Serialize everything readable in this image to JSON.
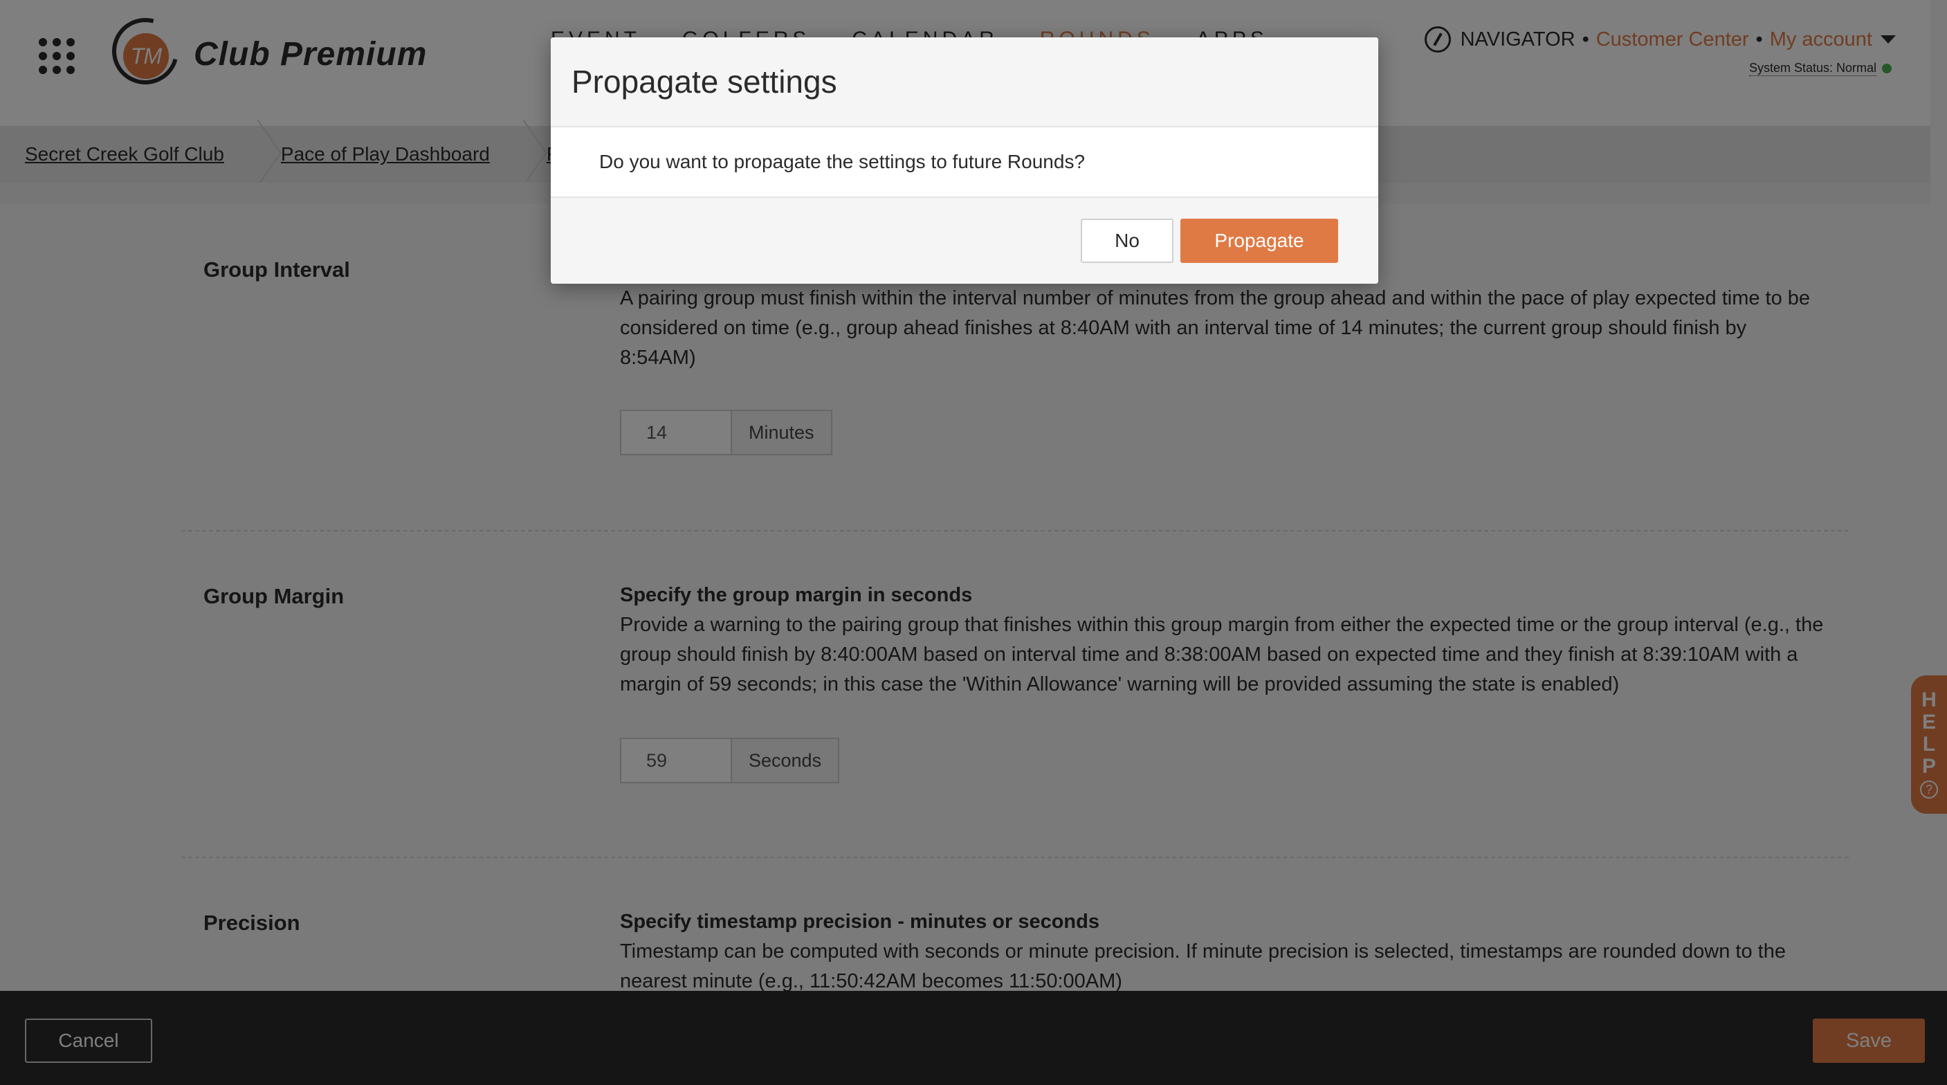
{
  "header": {
    "brand": "Club Premium",
    "logo_monogram": "TM",
    "nav": [
      "EVENT",
      "GOLFERS",
      "CALENDAR",
      "ROUNDS",
      "APPS"
    ],
    "navigator_label": "NAVIGATOR",
    "separator": "•",
    "customer_center": "Customer Center",
    "my_account": "My account",
    "system_status": "System Status: Normal",
    "accent_color": "#e07a45"
  },
  "breadcrumbs": [
    "Secret Creek Golf Club",
    "Pace of Play Dashboard",
    "Ro"
  ],
  "sections": {
    "group_interval": {
      "label": "Group Interval",
      "description": "A pairing group must finish within the interval number of minutes from the group ahead and within the pace of play expected time to be considered on time (e.g., group ahead finishes at 8:40AM with an interval time of 14 minutes; the current group should finish by 8:54AM)",
      "value": "14",
      "unit": "Minutes"
    },
    "group_margin": {
      "label": "Group Margin",
      "title": "Specify the group margin in seconds",
      "description": "Provide a warning to the pairing group that finishes within this group margin from either the expected time or the group interval (e.g., the group should finish by 8:40:00AM based on interval time and 8:38:00AM based on expected time and they finish at 8:39:10AM with a margin of 59 seconds; in this case the 'Within Allowance' warning will be provided assuming the state is enabled)",
      "value": "59",
      "unit": "Seconds"
    },
    "precision": {
      "label": "Precision",
      "title": "Specify timestamp precision - minutes or seconds",
      "description": "Timestamp can be computed with seconds or minute precision. If minute precision is selected, timestamps are rounded down to the nearest minute (e.g., 11:50:42AM becomes 11:50:00AM)"
    }
  },
  "footer": {
    "cancel_label": "Cancel",
    "save_label": "Save"
  },
  "help_tab": {
    "letters": [
      "H",
      "E",
      "L",
      "P"
    ],
    "icon_glyph": "?"
  },
  "modal": {
    "title": "Propagate settings",
    "message": "Do you want to propagate the settings to future Rounds?",
    "no_label": "No",
    "propagate_label": "Propagate"
  }
}
